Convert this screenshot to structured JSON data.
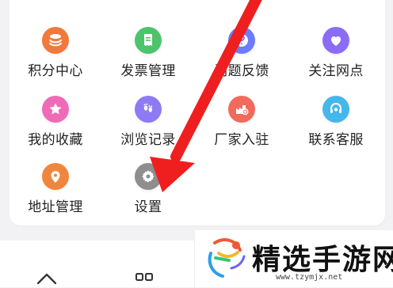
{
  "menu": {
    "items": [
      {
        "label": "积分中心",
        "icon": "coin-stack-icon",
        "color": "#f07a3c"
      },
      {
        "label": "发票管理",
        "icon": "invoice-icon",
        "color": "#4cc46b"
      },
      {
        "label": "问题反馈",
        "icon": "question-icon",
        "color": "#6d7bff"
      },
      {
        "label": "关注网点",
        "icon": "heart-icon",
        "color": "#8b6cf5"
      },
      {
        "label": "我的收藏",
        "icon": "star-icon",
        "color": "#ef6bb7"
      },
      {
        "label": "浏览记录",
        "icon": "footprint-icon",
        "color": "#8f7af5"
      },
      {
        "label": "厂家入驻",
        "icon": "factory-icon",
        "color": "#f26a5b"
      },
      {
        "label": "联系客服",
        "icon": "support-icon",
        "color": "#45b7ea"
      },
      {
        "label": "地址管理",
        "icon": "location-pin-icon",
        "color": "#f0863d"
      },
      {
        "label": "设置",
        "icon": "gear-icon",
        "color": "#8e8e8e"
      }
    ]
  },
  "overlay": {
    "annotation_color": "#ef1f1f"
  },
  "bottom_nav": {
    "icons": [
      "home-icon",
      "grid-icon"
    ]
  },
  "watermark": {
    "title": "精选手游网",
    "url": "www.tzymjx.net"
  }
}
